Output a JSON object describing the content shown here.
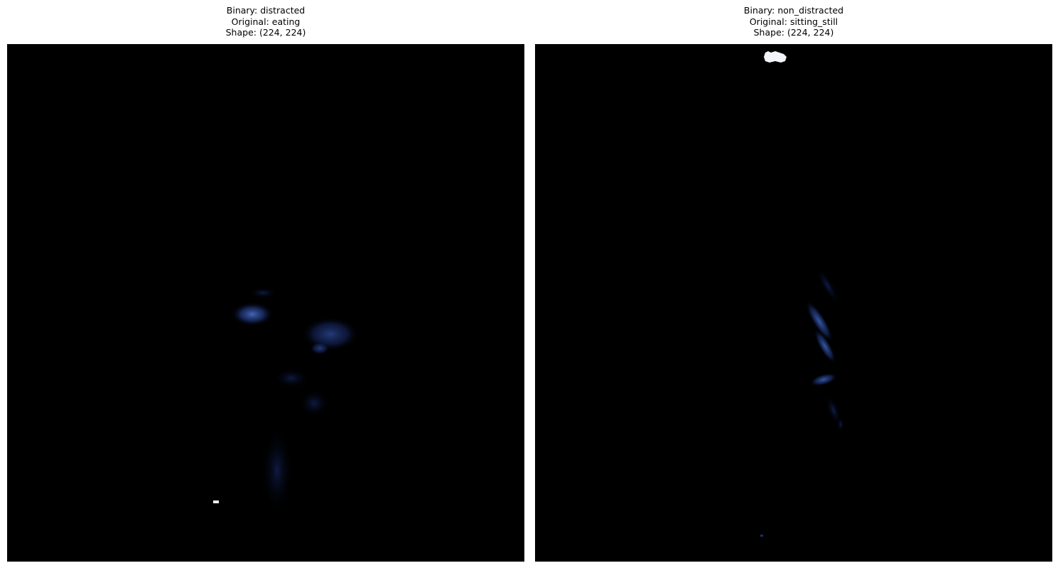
{
  "figure": {
    "panels": [
      {
        "title_lines": [
          "Binary: distracted",
          "Original: eating",
          "Shape: (224, 224)"
        ],
        "background_color": "#000000",
        "highlight_color": "#3a5aa8"
      },
      {
        "title_lines": [
          "Binary: non_distracted",
          "Original: sitting_still",
          "Shape: (224, 224)"
        ],
        "background_color": "#000000",
        "highlight_color": "#3a5aa8"
      }
    ]
  }
}
